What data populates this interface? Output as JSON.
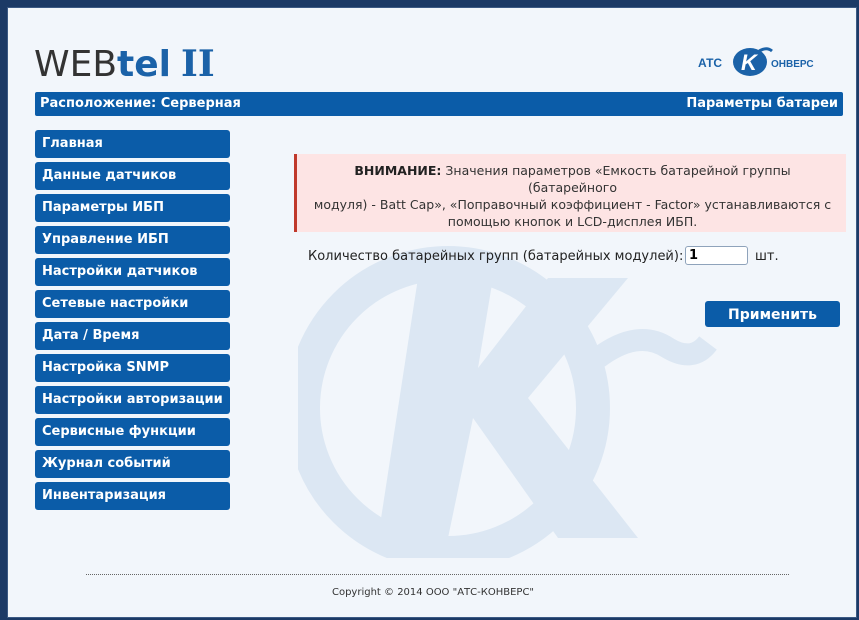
{
  "header": {
    "logo_web": "WEB",
    "logo_tel": "tel",
    "logo_ver": "II",
    "brand_left": "АТС",
    "brand_right": "ОНВЕРС",
    "brand_mark": "K"
  },
  "topbar": {
    "location": "Расположение: Серверная",
    "page_title": "Параметры батареи"
  },
  "sidebar": {
    "items": [
      {
        "label": "Главная"
      },
      {
        "label": "Данные датчиков"
      },
      {
        "label": "Параметры ИБП"
      },
      {
        "label": "Управление ИБП"
      },
      {
        "label": "Настройки датчиков"
      },
      {
        "label": "Сетевые настройки"
      },
      {
        "label": "Дата / Время"
      },
      {
        "label": "Настройка SNMP"
      },
      {
        "label": "Настройки авторизации"
      },
      {
        "label": "Сервисные функции"
      },
      {
        "label": "Журнал событий"
      },
      {
        "label": "Инвентаризация"
      }
    ]
  },
  "warning": {
    "title": "ВНИМАНИЕ:",
    "line1": "Значения параметров «Емкость батарейной группы (батарейного",
    "line2": "модуля) - Batt Cap», «Поправочный коэффициент - Factor» устанавливаются с",
    "line3": "помощью кнопок и LCD-дисплея ИБП."
  },
  "form": {
    "label": "Количество батарейных групп (батарейных модулей):",
    "value": "1",
    "unit": "шт.",
    "apply_label": "Применить"
  },
  "footer": {
    "copyright": "Copyright © 2014 ООО \"АТС-КОНВЕРС\""
  },
  "colors": {
    "accent": "#0b5ca8",
    "warning_bg": "#fde4e4",
    "warning_border": "#c0392b",
    "page_bg": "#f2f6fb",
    "outer_bg": "#1c3a66"
  }
}
